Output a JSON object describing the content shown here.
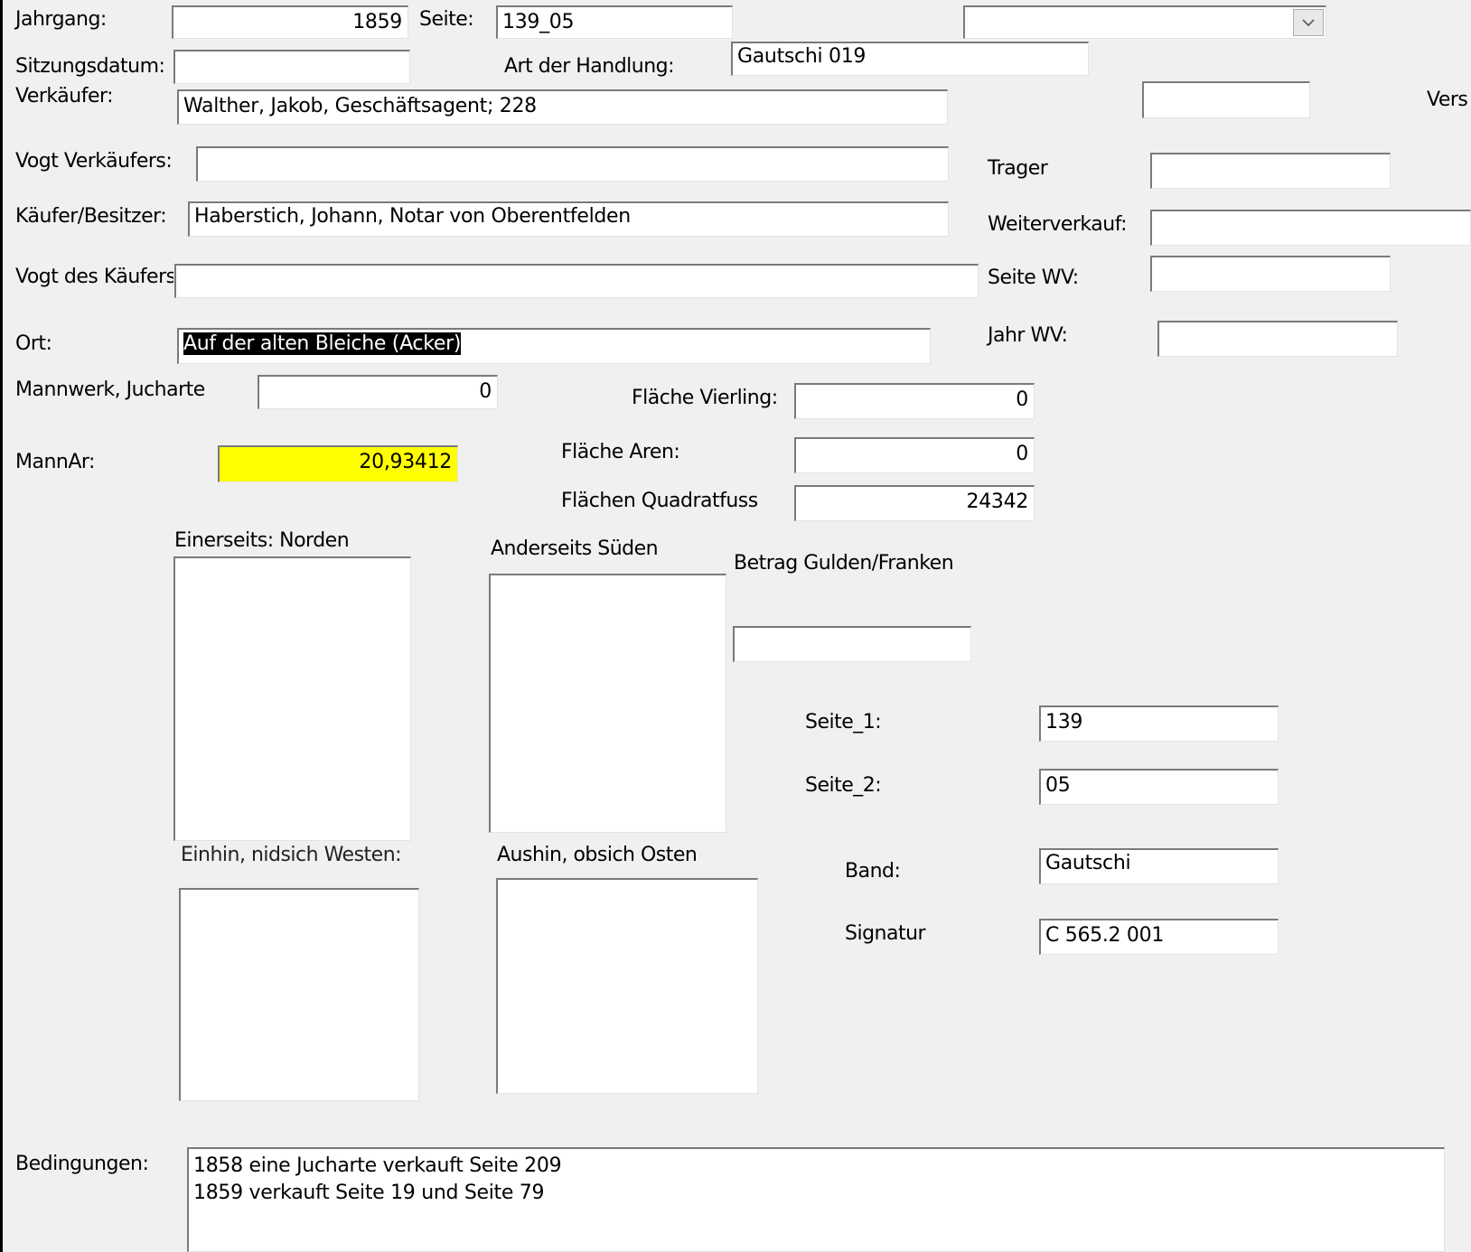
{
  "labels": {
    "jahrgang": "Jahrgang:",
    "seite": "Seite:",
    "sitzungsdatum": "Sitzungsdatum:",
    "art_der_handlung": "Art der Handlung:",
    "verkaeufer": "Verkäufer:",
    "vers": "Vers",
    "vogt_verkaeufers": "Vogt Verkäufers:",
    "trager": "Trager",
    "kaeufer_besitzer": "Käufer/Besitzer:",
    "weiterverkauf": "Weiterverkauf:",
    "vogt_des_kaeufers": "Vogt des Käufers:",
    "seite_wv": "Seite WV:",
    "ort": "Ort:",
    "jahr_wv": "Jahr WV:",
    "mannwerk_jucharte": "Mannwerk, Jucharte",
    "flaeche_vierling": "Fläche Vierling:",
    "mannar": "MannAr:",
    "flaeche_aren": "Fläche Aren:",
    "flaechen_quadratfuss": "Flächen Quadratfuss",
    "einerseits_norden": "Einerseits: Norden",
    "anderseits_sueden": "Anderseits Süden",
    "betrag_gulden_franken": "Betrag Gulden/Franken",
    "seite_1": "Seite_1:",
    "seite_2": "Seite_2:",
    "einhin_westen": "Einhin, nidsich Westen:",
    "aushin_osten": "Aushin,  obsich Osten",
    "band": "Band:",
    "signatur": "Signatur",
    "bedingungen": "Bedingungen:"
  },
  "fields": {
    "jahrgang": "1859",
    "seite": "139_05",
    "dropdown": "",
    "sitzungsdatum": "",
    "art_der_handlung": "Gautschi 019",
    "verkaeufer": "Walther, Jakob, Geschäftsagent; 228",
    "vers": "",
    "vogt_verkaeufers": "",
    "trager": "",
    "kaeufer_besitzer": "Haberstich, Johann, Notar von Oberentfelden",
    "weiterverkauf": "",
    "vogt_des_kaeufers": "",
    "seite_wv": "",
    "ort": "Auf der alten Bleiche (Acker)",
    "jahr_wv": "",
    "mannwerk_jucharte": "0",
    "flaeche_vierling": "0",
    "mannar": "20,93412",
    "flaeche_aren": "0",
    "flaechen_quadratfuss": "24342",
    "einerseits_norden": "",
    "anderseits_sueden": "",
    "betrag_gulden_franken": "",
    "seite_1": "139",
    "seite_2": "05",
    "einhin_westen": "",
    "aushin_osten": "",
    "band": "Gautschi",
    "signatur": "C 565.2 001",
    "bedingungen": "1858 eine Jucharte verkauft Seite 209\n1859 verkauft Seite 19 und Seite 79"
  },
  "colors": {
    "background": "#f0f0f0",
    "mannar_highlight": "#ffff00",
    "selection": "#000000"
  }
}
